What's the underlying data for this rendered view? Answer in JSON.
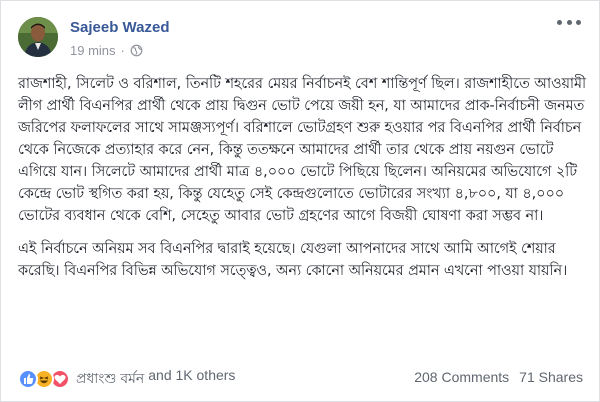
{
  "post": {
    "author": "Sajeeb Wazed",
    "time": "19 mins",
    "separator": "·",
    "privacy_icon": "globe-icon",
    "more_icon": "more-options-icon",
    "paragraphs": [
      "রাজশাহী, সিলেট ও বরিশাল, তিনটি শহরের মেয়র নির্বাচনই বেশ শান্তিপূর্ণ ছিল। রাজশাহীতে আওয়ামী লীগ প্রার্থী বিএনপির প্রার্থী থেকে প্রায় দ্বিগুন ভোট পেয়ে জয়ী হন, যা আমাদের প্রাক-নির্বাচনী জনমত জরিপের ফলাফলের সাথে সামঞ্জস্যপূর্ণ। বরিশালে ভোটগ্রহণ শুরু হওয়ার পর বিএনপির প্রার্থী নির্বাচন থেকে নিজেকে প্রত্যাহার করে নেন, কিন্তু ততক্ষনে আমাদের প্রার্থী তার থেকে প্রায় নয়গুন ভোটে এগিয়ে যান। সিলেটে আমাদের প্রার্থী মাত্র ৪,০০০ ভোটে পিছিয়ে ছিলেন। অনিয়মের অভিযোগে ২টি কেন্দ্রে ভোট স্থগিত করা হয়, কিন্তু যেহেতু সেই কেন্দ্রগুলোতে ভোটারের সংখ্যা ৪,৮০০, যা ৪,০০০ ভোটের ব্যবধান থেকে বেশি, সেহেতু আবার ভোট গ্রহণের আগে বিজয়ী ঘোষণা করা সম্ভব না।",
      "এই নির্বাচনে অনিয়ম সব বিএনপির দ্বারাই হয়েছে। যেগুলা আপনাদের সাথে আমি আগেই শেয়ার করেছি। বিএনপির বিভিন্ন অভিযোগ সত্ত্বেও, অন্য কোনো অনিয়মের প্রমান এখনো পাওয়া যায়নি।"
    ]
  },
  "reactions": {
    "icons": [
      "like-reaction-icon",
      "haha-reaction-icon",
      "love-reaction-icon"
    ],
    "first_name": "প্রধাংশু বর্মন",
    "others": "and 1K others",
    "colors": {
      "like": "#5890ff",
      "haha": "#f7b125",
      "love": "#f25268"
    }
  },
  "stats": {
    "comments": "208 Comments",
    "shares": "71 Shares"
  },
  "colors": {
    "author_link": "#385898",
    "meta_text": "#90949c",
    "body_text": "#1d2129"
  }
}
